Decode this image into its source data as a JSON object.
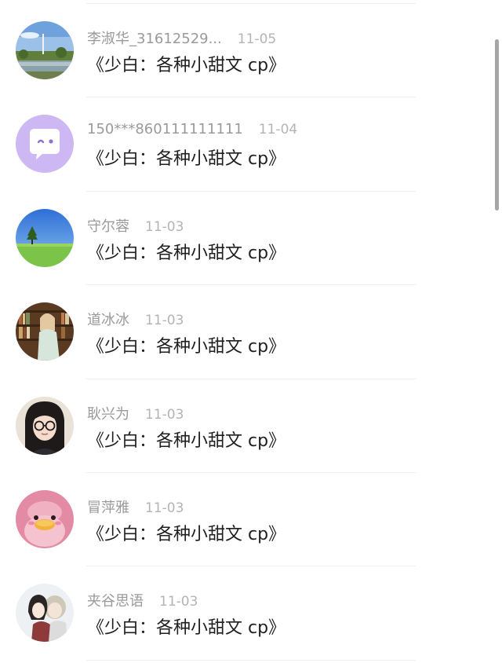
{
  "comments": [
    {
      "name": "李淑华_31612529...",
      "date": "11-05",
      "text": "《少白：各种小甜文 cp》",
      "avatar": "landscape-lake-avatar"
    },
    {
      "name": "150***860111111111",
      "date": "11-04",
      "text": "《少白：各种小甜文 cp》",
      "avatar": "chat-bubble-avatar"
    },
    {
      "name": "守尔蓉",
      "date": "11-03",
      "text": "《少白：各种小甜文 cp》",
      "avatar": "tree-field-avatar"
    },
    {
      "name": "道冰冰",
      "date": "11-03",
      "text": "《少白：各种小甜文 cp》",
      "avatar": "library-girl-avatar"
    },
    {
      "name": "耿兴为",
      "date": "11-03",
      "text": "《少白：各种小甜文 cp》",
      "avatar": "glasses-girl-avatar"
    },
    {
      "name": "冒萍雅",
      "date": "11-03",
      "text": "《少白：各种小甜文 cp》",
      "avatar": "pink-duck-avatar"
    },
    {
      "name": "夹谷思语",
      "date": "11-03",
      "text": "《少白：各种小甜文 cp》",
      "avatar": "anime-couple-avatar"
    }
  ],
  "colors": {
    "name": "#9a9a9a",
    "date": "#b4b4b4",
    "text": "#1f1f1f",
    "divider": "#efefef",
    "scrollbar": "#a6a6a6"
  }
}
